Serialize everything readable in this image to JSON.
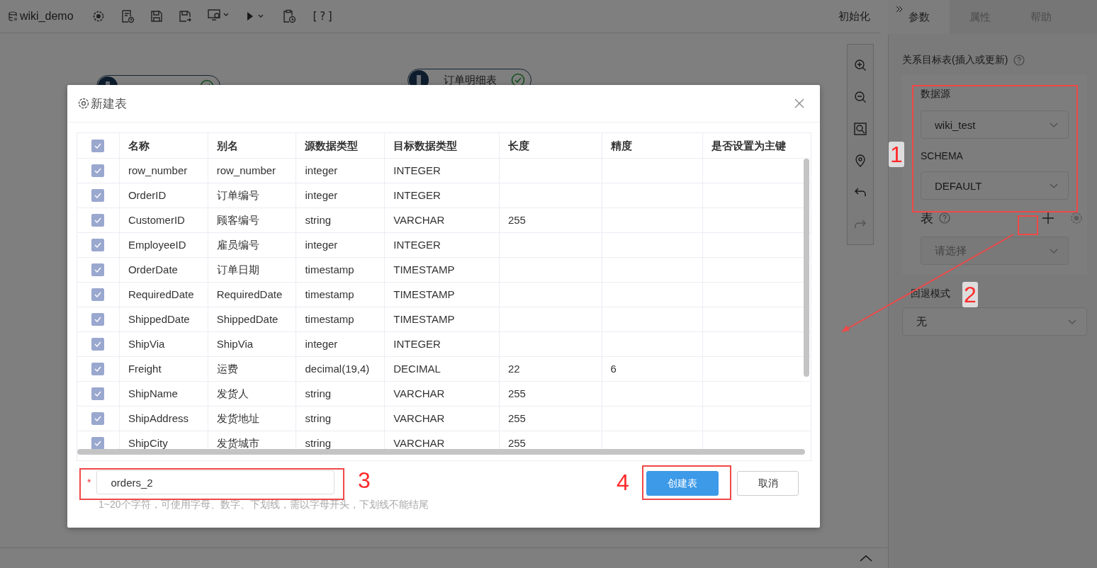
{
  "app": {
    "title": "wiki_demo",
    "help": "[?]",
    "init_button": "初始化"
  },
  "canvas": {
    "nodes": [
      {
        "valid": true
      },
      {
        "label": "订单明细表",
        "valid": true
      }
    ]
  },
  "panel": {
    "tabs": [
      {
        "label": "参数",
        "selected": true
      },
      {
        "label": "属性",
        "selected": false
      },
      {
        "label": "帮助",
        "selected": false
      }
    ],
    "section_title": "关系目标表(插入或更新)",
    "datasource_label": "数据源",
    "datasource_value": "wiki_test",
    "schema_label": "SCHEMA",
    "schema_value": "DEFAULT",
    "table_label": "表",
    "table_placeholder": "请选择",
    "rollback_label": "回退模式",
    "rollback_value": "无"
  },
  "dialog": {
    "title": "新建表",
    "header_checked": true,
    "columns": [
      "名称",
      "别名",
      "源数据类型",
      "目标数据类型",
      "长度",
      "精度",
      "是否设置为主键"
    ],
    "rows": [
      {
        "checked": true,
        "cells": [
          "row_number",
          "row_number",
          "integer",
          "INTEGER",
          "",
          "",
          ""
        ]
      },
      {
        "checked": true,
        "cells": [
          "OrderID",
          "订单编号",
          "integer",
          "INTEGER",
          "",
          "",
          ""
        ]
      },
      {
        "checked": true,
        "cells": [
          "CustomerID",
          "顾客编号",
          "string",
          "VARCHAR",
          "255",
          "",
          ""
        ]
      },
      {
        "checked": true,
        "cells": [
          "EmployeeID",
          "雇员编号",
          "integer",
          "INTEGER",
          "",
          "",
          ""
        ]
      },
      {
        "checked": true,
        "cells": [
          "OrderDate",
          "订单日期",
          "timestamp",
          "TIMESTAMP",
          "",
          "",
          ""
        ]
      },
      {
        "checked": true,
        "cells": [
          "RequiredDate",
          "RequiredDate",
          "timestamp",
          "TIMESTAMP",
          "",
          "",
          ""
        ]
      },
      {
        "checked": true,
        "cells": [
          "ShippedDate",
          "ShippedDate",
          "timestamp",
          "TIMESTAMP",
          "",
          "",
          ""
        ]
      },
      {
        "checked": true,
        "cells": [
          "ShipVia",
          "ShipVia",
          "integer",
          "INTEGER",
          "",
          "",
          ""
        ]
      },
      {
        "checked": true,
        "cells": [
          "Freight",
          "运费",
          "decimal(19,4)",
          "DECIMAL",
          "22",
          "6",
          ""
        ]
      },
      {
        "checked": true,
        "cells": [
          "ShipName",
          "发货人",
          "string",
          "VARCHAR",
          "255",
          "",
          ""
        ]
      },
      {
        "checked": true,
        "cells": [
          "ShipAddress",
          "发货地址",
          "string",
          "VARCHAR",
          "255",
          "",
          ""
        ]
      },
      {
        "checked": true,
        "cells": [
          "ShipCity",
          "发货城市",
          "string",
          "VARCHAR",
          "255",
          "",
          ""
        ]
      }
    ],
    "name_field": {
      "required_mark": "*",
      "value": "orders_2"
    },
    "hint": "1~20个字符，可使用字母、数字、下划线，需以字母开头，下划线不能结尾",
    "buttons": [
      {
        "label": "创建表",
        "kind": "primary"
      },
      {
        "label": "取消",
        "kind": "default"
      }
    ]
  },
  "annotations": [
    {
      "label": "1"
    },
    {
      "label": "2"
    },
    {
      "label": "3"
    },
    {
      "label": "4"
    }
  ]
}
